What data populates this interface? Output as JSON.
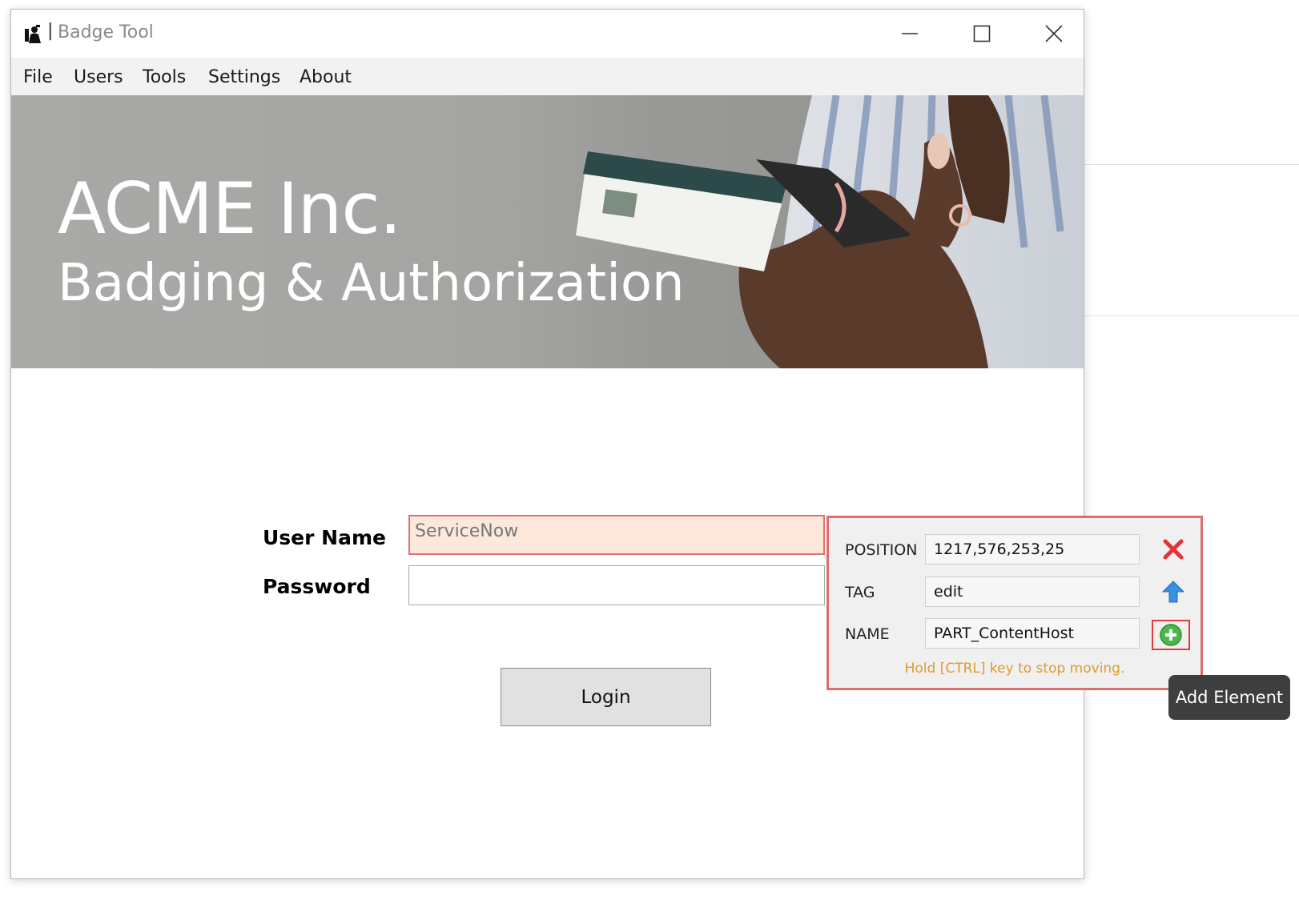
{
  "window": {
    "title": "Badge Tool",
    "separator": "|",
    "controls": {
      "minimize": "minimize-icon",
      "maximize": "maximize-icon",
      "close": "close-icon"
    }
  },
  "menu": {
    "items": [
      "File",
      "Users",
      "Tools",
      "Settings",
      "About"
    ]
  },
  "banner": {
    "line1": "ACME Inc.",
    "line2": "Badging & Authorization"
  },
  "login": {
    "username_label": "User Name",
    "username_value": "ServiceNow",
    "password_label": "Password",
    "password_value": "",
    "button_label": "Login"
  },
  "inspector": {
    "position_label": "POSITION",
    "position_value": "1217,576,253,25",
    "tag_label": "TAG",
    "tag_value": "edit",
    "name_label": "NAME",
    "name_value": "PART_ContentHost",
    "hint": "Hold [CTRL] key to stop moving.",
    "icons": {
      "remove": "red-x-icon",
      "parent": "up-arrow-icon",
      "add": "green-plus-icon"
    }
  },
  "tooltip": {
    "text": "Add Element"
  },
  "colors": {
    "highlight_border": "#e06d6d",
    "username_fill": "#fde8dc",
    "hint_text": "#e09a2a",
    "tooltip_bg": "#3e3e3e"
  }
}
